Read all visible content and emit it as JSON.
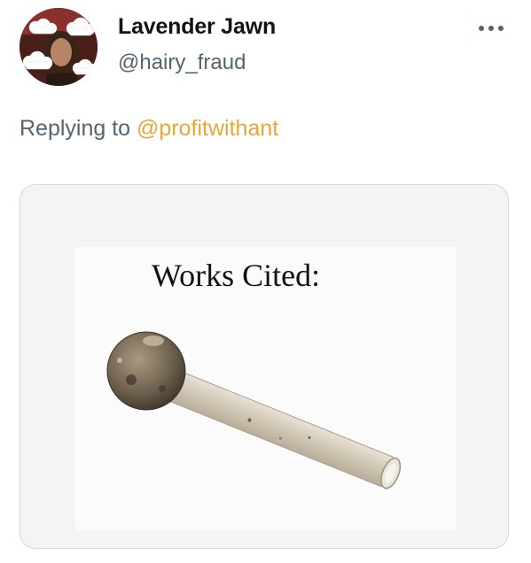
{
  "author": {
    "display_name": "Lavender Jawn",
    "handle": "@hairy_fraud"
  },
  "menu": {
    "more_icon": "more-horizontal-icon"
  },
  "reply": {
    "prefix": "Replying to",
    "mention": "@profitwithant"
  },
  "media": {
    "caption": "Works Cited:"
  },
  "colors": {
    "name": "#0f1419",
    "secondary": "#536471",
    "mention": "#e8a735",
    "card_border": "#cfd9de"
  }
}
